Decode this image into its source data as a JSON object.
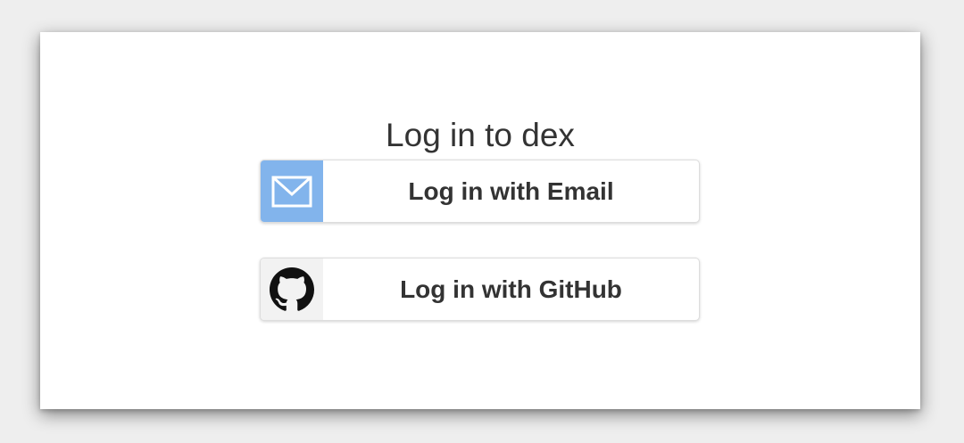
{
  "page": {
    "title": "Log in to dex"
  },
  "connectors": [
    {
      "label": "Log in with Email",
      "icon": "email-icon",
      "icon_bg": "#82b4ec"
    },
    {
      "label": "Log in with GitHub",
      "icon": "github-icon",
      "icon_bg": "#f2f2f2"
    }
  ],
  "colors": {
    "background": "#eeeeee",
    "card": "#ffffff",
    "text": "#333333"
  }
}
